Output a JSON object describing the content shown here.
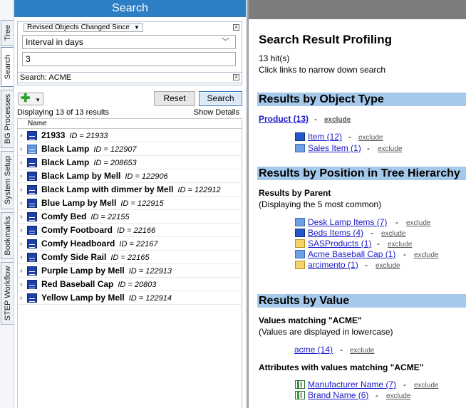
{
  "tabs": [
    "Tree",
    "Search",
    "BG Processes",
    "System Setup",
    "Bookmarks",
    "STEP Workflow"
  ],
  "left": {
    "title": "Search",
    "filter": {
      "type_label": "Revised Objects Changed Since",
      "unit": "Interval in days",
      "value": "3"
    },
    "search_term": "Search: ACME",
    "buttons": {
      "reset": "Reset",
      "search": "Search"
    },
    "count_text": "Displaying 13 of 13 results",
    "show_details": "Show Details",
    "column_header": "Name",
    "rows": [
      {
        "name": "21933",
        "id": "ID = 21933"
      },
      {
        "name": "Black Lamp",
        "id": "ID = 122907"
      },
      {
        "name": "Black Lamp",
        "id": "ID = 208653"
      },
      {
        "name": "Black Lamp by Mell",
        "id": "ID = 122906"
      },
      {
        "name": "Black Lamp with dimmer by Mell",
        "id": "ID = 122912"
      },
      {
        "name": "Blue Lamp by Mell",
        "id": "ID = 122915"
      },
      {
        "name": "Comfy Bed",
        "id": "ID = 22155"
      },
      {
        "name": "Comfy Footboard",
        "id": "ID = 22166"
      },
      {
        "name": "Comfy Headboard",
        "id": "ID = 22167"
      },
      {
        "name": "Comfy Side Rail",
        "id": "ID = 22165"
      },
      {
        "name": "Purple Lamp by Mell",
        "id": "ID = 122913"
      },
      {
        "name": "Red Baseball Cap",
        "id": "ID = 20803"
      },
      {
        "name": "Yellow Lamp by Mell",
        "id": "ID = 122914"
      }
    ]
  },
  "right": {
    "title": "Search Result Profiling",
    "hits": "13 hit(s)",
    "hint": "Click links to narrow down search",
    "exclude": "exclude",
    "dash": "-",
    "object_type": {
      "header": "Results by Object Type",
      "top": "Product (13)",
      "items": [
        "Item (12)",
        "Sales Item (1)"
      ]
    },
    "tree": {
      "header": "Results by Position in Tree Hierarchy",
      "sub": "Results by Parent",
      "note": "(Displaying the 5 most common)",
      "items": [
        "Desk Lamp Items (7)",
        "Beds Items (4)",
        "SASProducts (1)",
        "Acme Baseball Cap (1)",
        "arcimento (1)"
      ]
    },
    "value": {
      "header": "Results by Value",
      "sub": "Values matching \"ACME\"",
      "note": "(Values are displayed in lowercase)",
      "item": "acme (14)",
      "attr_sub": "Attributes with values matching \"ACME\"",
      "attrs": [
        "Manufacturer Name (7)",
        "Brand Name (6)"
      ]
    }
  }
}
